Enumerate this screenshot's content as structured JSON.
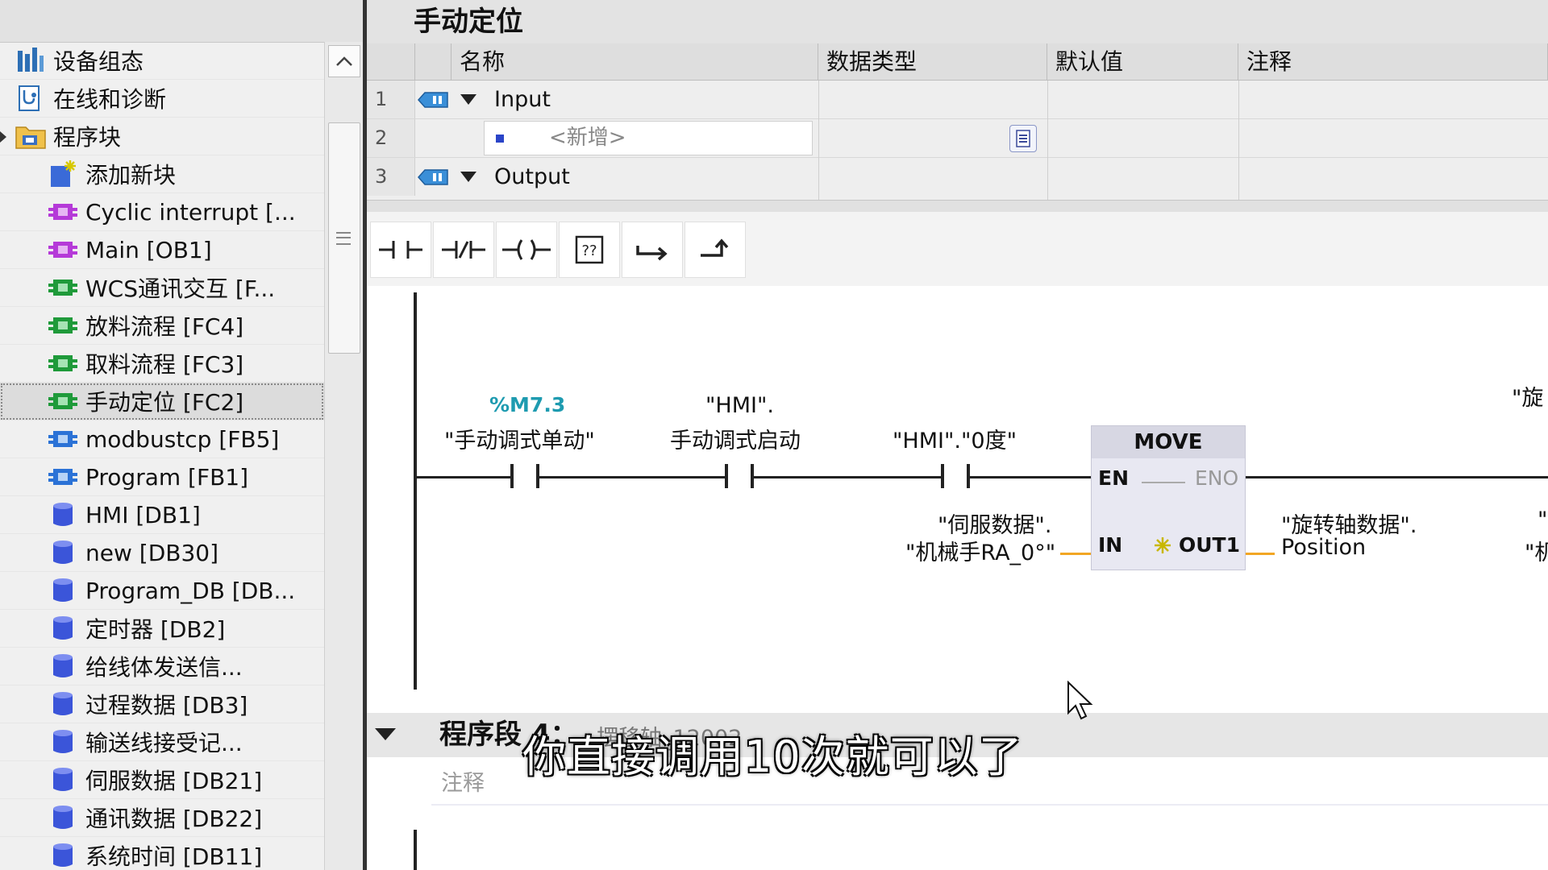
{
  "tree": {
    "items": [
      {
        "label": "设备组态",
        "icon": "device-config-icon"
      },
      {
        "label": "在线和诊断",
        "icon": "online-diagnostics-icon"
      },
      {
        "label": "程序块",
        "icon": "program-blocks-folder-icon"
      },
      {
        "label": "添加新块",
        "icon": "add-block-icon"
      },
      {
        "label": "Cyclic interrupt [...",
        "icon": "ob-block-icon"
      },
      {
        "label": "Main [OB1]",
        "icon": "ob-block-icon"
      },
      {
        "label": "WCS通讯交互 [F...",
        "icon": "fc-block-icon"
      },
      {
        "label": "放料流程 [FC4]",
        "icon": "fc-block-icon"
      },
      {
        "label": "取料流程 [FC3]",
        "icon": "fc-block-icon"
      },
      {
        "label": "手动定位 [FC2]",
        "icon": "fc-block-icon"
      },
      {
        "label": "modbustcp [FB5]",
        "icon": "fb-block-icon"
      },
      {
        "label": "Program [FB1]",
        "icon": "fb-block-icon"
      },
      {
        "label": "HMI [DB1]",
        "icon": "db-block-icon"
      },
      {
        "label": "new [DB30]",
        "icon": "db-block-icon"
      },
      {
        "label": "Program_DB [DB...",
        "icon": "db-block-icon"
      },
      {
        "label": "定时器 [DB2]",
        "icon": "db-block-icon"
      },
      {
        "label": "给线体发送信...",
        "icon": "db-block-icon"
      },
      {
        "label": "过程数据 [DB3]",
        "icon": "db-block-icon"
      },
      {
        "label": "输送线接受记...",
        "icon": "db-block-icon"
      },
      {
        "label": "伺服数据 [DB21]",
        "icon": "db-block-icon"
      },
      {
        "label": "通讯数据 [DB22]",
        "icon": "db-block-icon"
      },
      {
        "label": "系统时间 [DB11]",
        "icon": "db-block-icon"
      }
    ],
    "selected_index": 9
  },
  "editor": {
    "block_title": "手动定位",
    "interface": {
      "headers": {
        "name": "名称",
        "type": "数据类型",
        "default": "默认值",
        "comment": "注释"
      },
      "rows": [
        {
          "num": "1",
          "name": "Input"
        },
        {
          "num": "2",
          "placeholder": "<新增>"
        },
        {
          "num": "3",
          "name": "Output"
        }
      ]
    },
    "toolbar_icons": [
      "no-contact-icon",
      "nc-contact-icon",
      "coil-icon",
      "empty-box-icon",
      "open-branch-icon",
      "close-branch-icon"
    ],
    "ladder": {
      "contact1": {
        "address": "%M7.3",
        "tag": "\"手动调式单动\""
      },
      "contact2": {
        "line1": "\"HMI\".",
        "line2": "手动调式启动"
      },
      "contact3": {
        "tag": "\"HMI\".\"0度\""
      },
      "move": {
        "title": "MOVE",
        "en": "EN",
        "eno": "ENO",
        "in": "IN",
        "out": "OUT1"
      },
      "in_operand": {
        "line1": "\"伺服数据\".",
        "line2": "\"机械手RA_0°\""
      },
      "out_operand": {
        "line1": "\"旋转轴数据\".",
        "line2": "Position"
      },
      "cut_right_top": "\"旋",
      "cut_right_mid": "\"",
      "cut_right_low": "\"机"
    },
    "network4": {
      "title": "程序段 4：",
      "subtitle": "摆移轴_12002",
      "comment_placeholder": "注释"
    }
  },
  "subtitle": "你直接调用10次就可以了",
  "colors": {
    "teal_address": "#1e9bb0",
    "orange_wire": "#f2a623",
    "selected_row": "#dcdcdc"
  }
}
